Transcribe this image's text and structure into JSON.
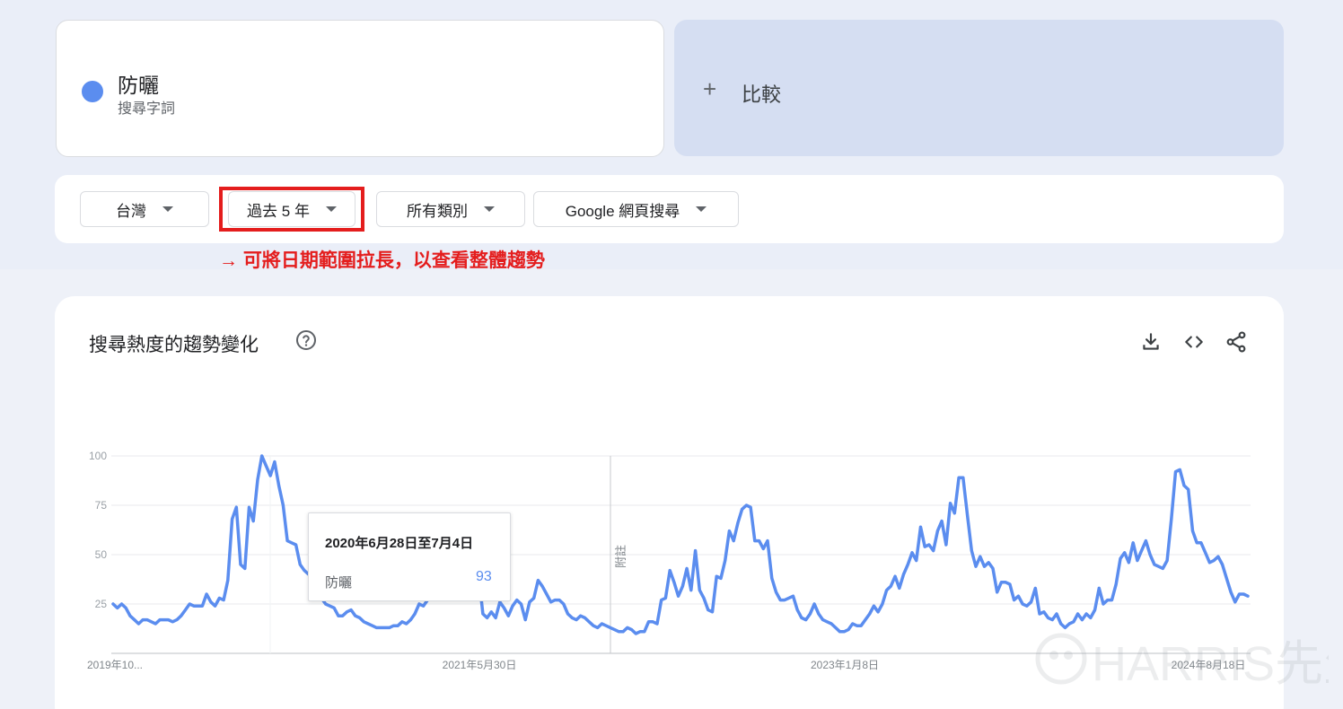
{
  "search_term": {
    "name": "防曬",
    "type": "搜尋字詞",
    "color": "#5b8def"
  },
  "compare": {
    "label": "比較"
  },
  "filters": [
    {
      "label": "台灣"
    },
    {
      "label": "過去 5 年"
    },
    {
      "label": "所有類別"
    },
    {
      "label": "Google 網頁搜尋"
    }
  ],
  "annotation": {
    "text": "→ 可將日期範圍拉長，以查看整體趨勢",
    "color": "#e41d1d"
  },
  "chart_card": {
    "title": "搜尋熱度的趨勢變化"
  },
  "tooltip": {
    "date": "2020年6月28日至7月4日",
    "term": "防曬",
    "value": "93"
  },
  "chart_data": {
    "type": "line",
    "y_ticks": [
      "100",
      "75",
      "50",
      "25"
    ],
    "x_tick_labels": [
      "2019年10...",
      "2021年5月30日",
      "2023年1月8日",
      "2024年8月18日"
    ],
    "note_label": "附註",
    "ylim": [
      0,
      100
    ],
    "grid": true,
    "series": [
      {
        "color": "#5b8def",
        "values": [
          25,
          23,
          25,
          23,
          19,
          17,
          15,
          17,
          17,
          16,
          15,
          17,
          17,
          17,
          16,
          17,
          19,
          22,
          25,
          24,
          24,
          24,
          30,
          26,
          24,
          28,
          27,
          37,
          68,
          74,
          45,
          43,
          74,
          67,
          88,
          100,
          95,
          90,
          97,
          85,
          75,
          57,
          56,
          55,
          45,
          42,
          40,
          38,
          30,
          28,
          25,
          24,
          23,
          19,
          19,
          21,
          22,
          19,
          18,
          16,
          15,
          14,
          13,
          13,
          13,
          13,
          14,
          14,
          16,
          15,
          17,
          20,
          25,
          24,
          27,
          30,
          35,
          40,
          43,
          38,
          41,
          44,
          43,
          45,
          50,
          54,
          40,
          20,
          18,
          21,
          18,
          26,
          23,
          19,
          24,
          27,
          25,
          17,
          26,
          28,
          37,
          34,
          30,
          26,
          27,
          27,
          25,
          20,
          18,
          17,
          19,
          18,
          16,
          14,
          13,
          15,
          14,
          13,
          12,
          11,
          11,
          13,
          12,
          10,
          11,
          11,
          16,
          16,
          15,
          27,
          28,
          42,
          36,
          29,
          34,
          43,
          32,
          52,
          32,
          28,
          22,
          21,
          39,
          38,
          47,
          62,
          57,
          66,
          73,
          75,
          74,
          57,
          57,
          53,
          57,
          38,
          31,
          27,
          27,
          28,
          29,
          22,
          18,
          17,
          20,
          25,
          20,
          17,
          16,
          15,
          13,
          11,
          11,
          12,
          15,
          14,
          14,
          17,
          20,
          24,
          21,
          25,
          32,
          34,
          39,
          33,
          40,
          45,
          51,
          47,
          64,
          54,
          55,
          52,
          62,
          67,
          55,
          76,
          71,
          89,
          89,
          70,
          52,
          44,
          49,
          44,
          46,
          43,
          31,
          36,
          36,
          35,
          27,
          29,
          25,
          24,
          26,
          33,
          20,
          21,
          18,
          17,
          20,
          15,
          13,
          15,
          16,
          20,
          17,
          20,
          18,
          22,
          33,
          25,
          27,
          27,
          35,
          48,
          51,
          46,
          56,
          47,
          52,
          57,
          50,
          45,
          44,
          43,
          47,
          68,
          92,
          93,
          85,
          83,
          62,
          56,
          56,
          51,
          46,
          47,
          49,
          45,
          38,
          31,
          26,
          30,
          30,
          29
        ]
      }
    ]
  },
  "watermark": {
    "text": "HARRIS先生"
  }
}
